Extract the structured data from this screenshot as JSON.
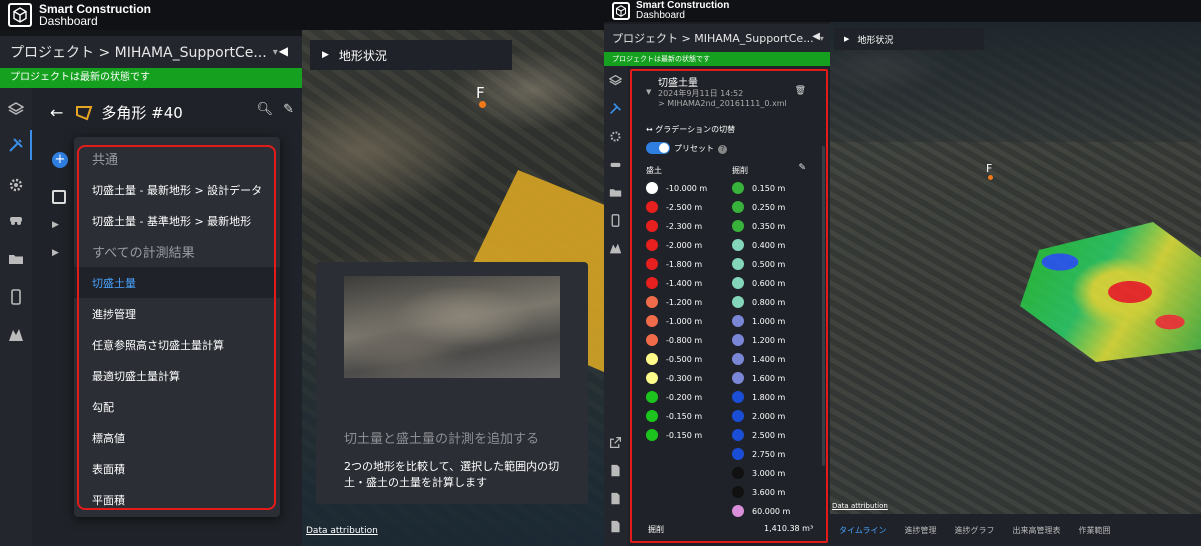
{
  "brand": {
    "line1": "Smart Construction",
    "line2": "Dashboard"
  },
  "left": {
    "project_label": "プロジェクト > MIHAMA_SupportCe...",
    "project_caret": "▾",
    "collapse": "◀",
    "status": "プロジェクトは最新の状態です",
    "panel_title": "多角形 #40",
    "back_arrow": "←",
    "plus": "+",
    "menu": {
      "section1": "共通",
      "items1": [
        "切盛土量 - 最新地形 > 設計データ",
        "切盛土量 - 基準地形 > 最新地形"
      ],
      "section2": "すべての計測結果",
      "items2": [
        "切盛土量",
        "進捗管理",
        "任意参照高さ切盛土量計算",
        "最適切盛土量計算",
        "勾配",
        "標高値",
        "表面積",
        "平面積"
      ],
      "selected": "切盛土量"
    },
    "map_tab": "地形状況",
    "marker": "F",
    "tooltip_title": "切土量と盛土量の計測を追加する",
    "tooltip_desc": "2つの地形を比較して、選択した範囲内の切土・盛土の土量を計算します",
    "attribution": "Data attribution"
  },
  "right": {
    "project_label": "プロジェクト > MIHAMA_SupportCe...",
    "project_caret": "▾",
    "collapse": "◀",
    "status": "プロジェクトは最新の状態です",
    "result_title": "切盛土量",
    "result_date": "2024年9月11日 14:52",
    "result_file": "> MIHAMA2nd_20161111_0.xml",
    "gradient_switch": "グラデーションの切替",
    "preset": "プリセット",
    "fill_header": "盛土",
    "cut_header": "掘削",
    "fill_values": [
      {
        "v": "-10.000 m",
        "c": "#ffffff"
      },
      {
        "v": "-2.500 m",
        "c": "#e81f1f"
      },
      {
        "v": "-2.300 m",
        "c": "#e81f1f"
      },
      {
        "v": "-2.000 m",
        "c": "#e81f1f"
      },
      {
        "v": "-1.800 m",
        "c": "#e81f1f"
      },
      {
        "v": "-1.400 m",
        "c": "#e81f1f"
      },
      {
        "v": "-1.200 m",
        "c": "#f06b4a"
      },
      {
        "v": "-1.000 m",
        "c": "#f06b4a"
      },
      {
        "v": "-0.800 m",
        "c": "#f06b4a"
      },
      {
        "v": "-0.500 m",
        "c": "#fffb8a"
      },
      {
        "v": "-0.300 m",
        "c": "#fffb8a"
      },
      {
        "v": "-0.200 m",
        "c": "#1ec41e"
      },
      {
        "v": "-0.150 m",
        "c": "#1ec41e"
      },
      {
        "v": "-0.150 m",
        "c": "#1ec41e"
      }
    ],
    "cut_values": [
      {
        "v": "0.150 m",
        "c": "#38b23a"
      },
      {
        "v": "0.250 m",
        "c": "#38b23a"
      },
      {
        "v": "0.350 m",
        "c": "#38b23a"
      },
      {
        "v": "0.400 m",
        "c": "#84d6ba"
      },
      {
        "v": "0.500 m",
        "c": "#84d6ba"
      },
      {
        "v": "0.600 m",
        "c": "#84d6ba"
      },
      {
        "v": "0.800 m",
        "c": "#84d6ba"
      },
      {
        "v": "1.000 m",
        "c": "#7a86d6"
      },
      {
        "v": "1.200 m",
        "c": "#7a86d6"
      },
      {
        "v": "1.400 m",
        "c": "#7a86d6"
      },
      {
        "v": "1.600 m",
        "c": "#7a86d6"
      },
      {
        "v": "1.800 m",
        "c": "#1b4ed6"
      },
      {
        "v": "2.000 m",
        "c": "#1b4ed6"
      },
      {
        "v": "2.500 m",
        "c": "#1b4ed6"
      },
      {
        "v": "2.750 m",
        "c": "#1b4ed6"
      },
      {
        "v": "3.000 m",
        "c": "#111111"
      },
      {
        "v": "3.600 m",
        "c": "#111111"
      },
      {
        "v": "60.000 m",
        "c": "#d98fd9"
      }
    ],
    "total_label": "掘削",
    "total_value": "1,410.38 m³",
    "map_tab": "地形状況",
    "marker": "F",
    "attribution": "Data attribution",
    "bottom_tabs": [
      "タイムライン",
      "進捗管理",
      "進捗グラフ",
      "出来高管理表",
      "作業範囲"
    ],
    "active_tab": "タイムライン"
  },
  "colors": {
    "accent": "#2f7fe0",
    "status_green": "#15a11f",
    "highlight_red": "#e31b1b",
    "selected_text": "#4aa3ff"
  }
}
